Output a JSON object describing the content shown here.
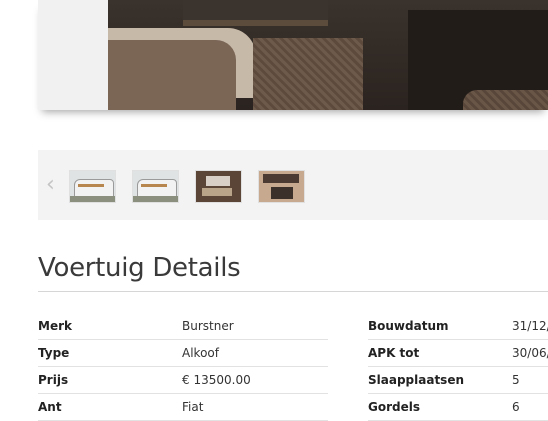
{
  "gallery": {
    "prev_symbol": "‹",
    "thumbnails": [
      {
        "icon": "camper-exterior-photo"
      },
      {
        "icon": "camper-exterior-photo"
      },
      {
        "icon": "camper-interior-photo"
      },
      {
        "icon": "camper-interior-photo"
      }
    ]
  },
  "details": {
    "title": "Voertuig Details",
    "left": [
      {
        "label": "Merk",
        "value": "Burstner"
      },
      {
        "label": "Type",
        "value": "Alkoof"
      },
      {
        "label": "Prijs",
        "value": "€ 13500.00"
      },
      {
        "label": "Ant",
        "value": "Fiat"
      }
    ],
    "right": [
      {
        "label": "Bouwdatum",
        "value": "31/12/"
      },
      {
        "label": "APK tot",
        "value": "30/06/"
      },
      {
        "label": "Slaapplaatsen",
        "value": "5"
      },
      {
        "label": "Gordels",
        "value": "6"
      }
    ]
  }
}
